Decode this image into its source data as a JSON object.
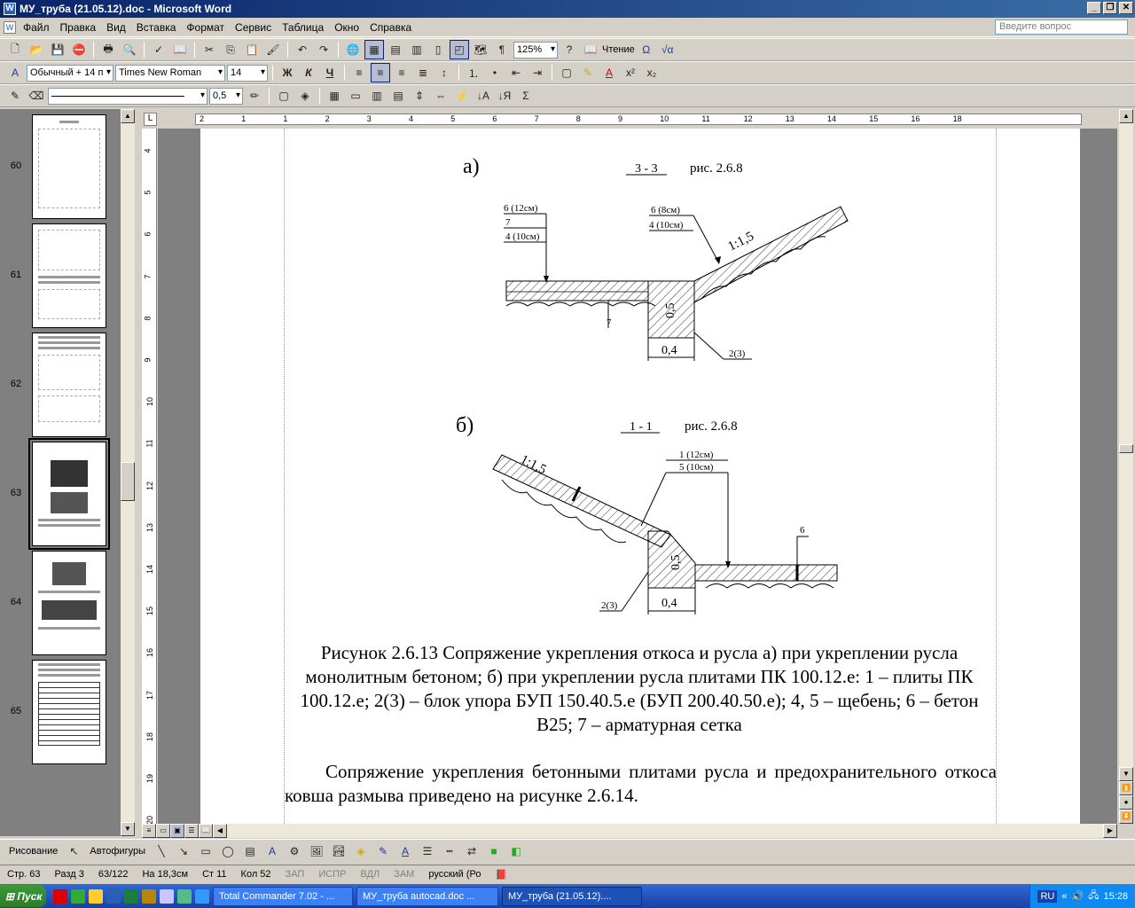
{
  "window": {
    "title": "МУ_труба (21.05.12).doc - Microsoft Word"
  },
  "menu": {
    "items": [
      "Файл",
      "Правка",
      "Вид",
      "Вставка",
      "Формат",
      "Сервис",
      "Таблица",
      "Окно",
      "Справка"
    ],
    "ask_placeholder": "Введите вопрос"
  },
  "toolbar_standard": {
    "zoom": "125%",
    "reading": "Чтение"
  },
  "toolbar_format": {
    "style": "Обычный + 14 п",
    "font": "Times New Roman",
    "size": "14"
  },
  "toolbar_tables": {
    "line_width": "0,5"
  },
  "thumbnails": [
    {
      "num": "60"
    },
    {
      "num": "61"
    },
    {
      "num": "62"
    },
    {
      "num": "63",
      "selected": true
    },
    {
      "num": "64"
    },
    {
      "num": "65"
    }
  ],
  "ruler": {
    "h_ticks": [
      "2",
      "1",
      "1",
      "2",
      "3",
      "4",
      "5",
      "6",
      "7",
      "8",
      "9",
      "10",
      "11",
      "12",
      "13",
      "14",
      "15",
      "16",
      "18"
    ],
    "v_ticks": [
      "4",
      "5",
      "6",
      "7",
      "8",
      "9",
      "10",
      "11",
      "12",
      "13",
      "14",
      "15",
      "16",
      "17",
      "18",
      "19",
      "20"
    ]
  },
  "figure": {
    "a_label": "а)",
    "a_section": "3 - 3",
    "a_ref": "рис. 2.6.8",
    "a_left_1": "6 (12см)",
    "a_left_2": "7",
    "a_left_3": "4 (10см)",
    "a_right_1": "6 (8см)",
    "a_right_2": "4 (10см)",
    "a_slope": "1:1,5",
    "a_height": "0,5",
    "a_width": "0,4",
    "a_mark7": "7",
    "a_block": "2(3)",
    "b_label": "б)",
    "b_section": "1 - 1",
    "b_ref": "рис. 2.6.8",
    "b_slope": "1:1,5",
    "b_top_1": "1 (12см)",
    "b_top_2": "5 (10см)",
    "b_mark6": "6",
    "b_height": "0,5",
    "b_width": "0,4",
    "b_block": "2(3)"
  },
  "caption": "Рисунок 2.6.13 Сопряжение укрепления откоса и русла а) при укреплении русла монолитным бетоном; б) при укреплении русла плитами ПК 100.12.е: 1 – плиты ПК 100.12.е; 2(3) – блок упора БУП 150.40.5.е (БУП 200.40.50.е); 4, 5 – щебень; 6 – бетон В25; 7 – арматурная сетка",
  "paragraph": "Сопряжение укрепления бетонными плитами русла и предохранительного откоса ковша размыва приведено на рисунке 2.6.14.",
  "drawing_toolbar": {
    "draw": "Рисование",
    "autoshapes": "Автофигуры"
  },
  "status": {
    "page": "Стр. 63",
    "section": "Разд 3",
    "pages": "63/122",
    "at": "На 18,3см",
    "line": "Ст 11",
    "col": "Кол 52",
    "rec": "ЗАП",
    "trk": "ИСПР",
    "ext": "ВДЛ",
    "ovr": "ЗАМ",
    "lang": "русский (Ро"
  },
  "taskbar": {
    "start": "Пуск",
    "tasks": [
      "Total Commander 7.02 - ...",
      "МУ_труба autocad.doc ...",
      "МУ_труба (21.05.12)...."
    ],
    "lang": "RU",
    "time": "15:28"
  }
}
